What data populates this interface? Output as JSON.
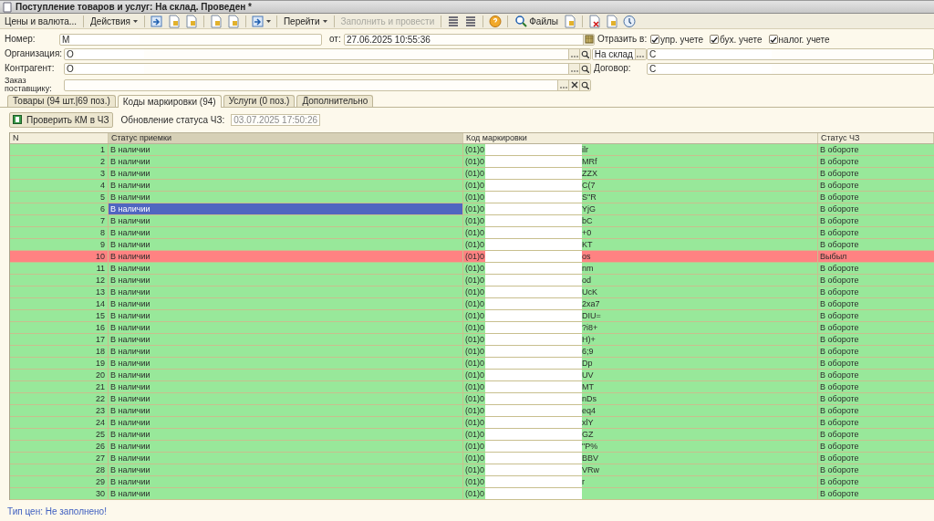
{
  "window": {
    "title": "Поступление товаров и услуг: На склад. Проведен *"
  },
  "toolbar": [
    {
      "kind": "text",
      "label": "Цены и валюта...",
      "dropdown": false,
      "disabled": false
    },
    {
      "kind": "sep"
    },
    {
      "kind": "text",
      "label": "Действия",
      "dropdown": true,
      "disabled": false
    },
    {
      "kind": "sep"
    },
    {
      "kind": "icon"
    },
    {
      "kind": "icon"
    },
    {
      "kind": "icon"
    },
    {
      "kind": "sep"
    },
    {
      "kind": "icon"
    },
    {
      "kind": "icon"
    },
    {
      "kind": "sep"
    },
    {
      "kind": "icon",
      "dropdown": true
    },
    {
      "kind": "sep"
    },
    {
      "kind": "text",
      "label": "Перейти",
      "dropdown": true,
      "disabled": false
    },
    {
      "kind": "sep"
    },
    {
      "kind": "text",
      "label": "Заполнить и провести",
      "dropdown": false,
      "disabled": true
    },
    {
      "kind": "sep"
    },
    {
      "kind": "icon"
    },
    {
      "kind": "icon"
    },
    {
      "kind": "sep"
    },
    {
      "kind": "icon"
    },
    {
      "kind": "sep"
    },
    {
      "kind": "files",
      "label": "Файлы"
    },
    {
      "kind": "icon"
    },
    {
      "kind": "sep"
    },
    {
      "kind": "icon"
    },
    {
      "kind": "icon"
    },
    {
      "kind": "icon"
    }
  ],
  "form": {
    "number": {
      "label": "Номер:",
      "value": "М"
    },
    "date": {
      "label": "от:",
      "value": "27.06.2025 10:55:36"
    },
    "reflect": {
      "label": "Отразить в:",
      "checkboxes": [
        {
          "label": "упр. учете",
          "checked": true
        },
        {
          "label": "бух. учете",
          "checked": true
        },
        {
          "label": "налог. учете",
          "checked": true
        }
      ]
    },
    "organization": {
      "label": "Организация:",
      "value": "О"
    },
    "operation": {
      "value": "На склад"
    },
    "warehouse": {
      "value": "С"
    },
    "counterparty": {
      "label": "Контрагент:",
      "value": "О"
    },
    "contract": {
      "label": "Договор:",
      "value": "С"
    },
    "supplier_order": {
      "label": "Заказ поставщику:"
    }
  },
  "tabs": [
    {
      "label": "Товары (94 шт.|69 поз.)",
      "selected": false
    },
    {
      "label": "Коды маркировки (94)",
      "selected": true
    },
    {
      "label": "Услуги (0 поз.)",
      "selected": false
    },
    {
      "label": "Дополнительно",
      "selected": false
    }
  ],
  "check_button": {
    "label": "Проверить КМ в ЧЗ"
  },
  "status_update": {
    "label": "Обновление статуса ЧЗ:",
    "value": "03.07.2025 17:50:26"
  },
  "table": {
    "columns": [
      "N",
      "Статус приемки",
      "Код маркировки",
      "Статус ЧЗ"
    ],
    "rows": [
      {
        "n": "1",
        "receipt_status": "В наличии",
        "code_prefix": "(01)0",
        "code_suffix": "ilr",
        "cz_status": "В обороте",
        "color": "#98e89a",
        "selected": false
      },
      {
        "n": "2",
        "receipt_status": "В наличии",
        "code_prefix": "(01)0",
        "code_suffix": "MRf",
        "cz_status": "В обороте",
        "color": "#98e89a",
        "selected": false
      },
      {
        "n": "3",
        "receipt_status": "В наличии",
        "code_prefix": "(01)0",
        "code_suffix": "ZZX",
        "cz_status": "В обороте",
        "color": "#98e89a",
        "selected": false
      },
      {
        "n": "4",
        "receipt_status": "В наличии",
        "code_prefix": "(01)0",
        "code_suffix": "C(7",
        "cz_status": "В обороте",
        "color": "#98e89a",
        "selected": false
      },
      {
        "n": "5",
        "receipt_status": "В наличии",
        "code_prefix": "(01)0",
        "code_suffix": "S\"R",
        "cz_status": "В обороте",
        "color": "#98e89a",
        "selected": false
      },
      {
        "n": "6",
        "receipt_status": "В наличии",
        "code_prefix": "(01)0",
        "code_suffix": "YjG",
        "cz_status": "В обороте",
        "color": "#98e89a",
        "selected": true
      },
      {
        "n": "7",
        "receipt_status": "В наличии",
        "code_prefix": "(01)0",
        "code_suffix": "bC",
        "cz_status": "В обороте",
        "color": "#98e89a",
        "selected": false
      },
      {
        "n": "8",
        "receipt_status": "В наличии",
        "code_prefix": "(01)0",
        "code_suffix": "+0",
        "cz_status": "В обороте",
        "color": "#98e89a",
        "selected": false
      },
      {
        "n": "9",
        "receipt_status": "В наличии",
        "code_prefix": "(01)0",
        "code_suffix": "KT",
        "cz_status": "В обороте",
        "color": "#98e89a",
        "selected": false
      },
      {
        "n": "10",
        "receipt_status": "В наличии",
        "code_prefix": "(01)0",
        "code_suffix": "os",
        "cz_status": "Выбыл",
        "color": "#ff8282",
        "selected": false
      },
      {
        "n": "11",
        "receipt_status": "В наличии",
        "code_prefix": "(01)0",
        "code_suffix": "nm",
        "cz_status": "В обороте",
        "color": "#98e89a",
        "selected": false
      },
      {
        "n": "12",
        "receipt_status": "В наличии",
        "code_prefix": "(01)0",
        "code_suffix": "od",
        "cz_status": "В обороте",
        "color": "#98e89a",
        "selected": false
      },
      {
        "n": "13",
        "receipt_status": "В наличии",
        "code_prefix": "(01)0",
        "code_suffix": "UcK",
        "cz_status": "В обороте",
        "color": "#98e89a",
        "selected": false
      },
      {
        "n": "14",
        "receipt_status": "В наличии",
        "code_prefix": "(01)0",
        "code_suffix": "2xa7",
        "cz_status": "В обороте",
        "color": "#98e89a",
        "selected": false
      },
      {
        "n": "15",
        "receipt_status": "В наличии",
        "code_prefix": "(01)0",
        "code_suffix": "DIU=",
        "cz_status": "В обороте",
        "color": "#98e89a",
        "selected": false
      },
      {
        "n": "16",
        "receipt_status": "В наличии",
        "code_prefix": "(01)0",
        "code_suffix": "?i8+",
        "cz_status": "В обороте",
        "color": "#98e89a",
        "selected": false
      },
      {
        "n": "17",
        "receipt_status": "В наличии",
        "code_prefix": "(01)0",
        "code_suffix": "H)+",
        "cz_status": "В обороте",
        "color": "#98e89a",
        "selected": false
      },
      {
        "n": "18",
        "receipt_status": "В наличии",
        "code_prefix": "(01)0",
        "code_suffix": "6;9",
        "cz_status": "В обороте",
        "color": "#98e89a",
        "selected": false
      },
      {
        "n": "19",
        "receipt_status": "В наличии",
        "code_prefix": "(01)0",
        "code_suffix": "Dp",
        "cz_status": "В обороте",
        "color": "#98e89a",
        "selected": false
      },
      {
        "n": "20",
        "receipt_status": "В наличии",
        "code_prefix": "(01)0",
        "code_suffix": "UV",
        "cz_status": "В обороте",
        "color": "#98e89a",
        "selected": false
      },
      {
        "n": "21",
        "receipt_status": "В наличии",
        "code_prefix": "(01)0",
        "code_suffix": "MT",
        "cz_status": "В обороте",
        "color": "#98e89a",
        "selected": false
      },
      {
        "n": "22",
        "receipt_status": "В наличии",
        "code_prefix": "(01)0",
        "code_suffix": "nDs",
        "cz_status": "В обороте",
        "color": "#98e89a",
        "selected": false
      },
      {
        "n": "23",
        "receipt_status": "В наличии",
        "code_prefix": "(01)0",
        "code_suffix": "eq4",
        "cz_status": "В обороте",
        "color": "#98e89a",
        "selected": false
      },
      {
        "n": "24",
        "receipt_status": "В наличии",
        "code_prefix": "(01)0",
        "code_suffix": "xlY",
        "cz_status": "В обороте",
        "color": "#98e89a",
        "selected": false
      },
      {
        "n": "25",
        "receipt_status": "В наличии",
        "code_prefix": "(01)0",
        "code_suffix": "GZ",
        "cz_status": "В обороте",
        "color": "#98e89a",
        "selected": false
      },
      {
        "n": "26",
        "receipt_status": "В наличии",
        "code_prefix": "(01)0",
        "code_suffix": "\"P%",
        "cz_status": "В обороте",
        "color": "#98e89a",
        "selected": false
      },
      {
        "n": "27",
        "receipt_status": "В наличии",
        "code_prefix": "(01)0",
        "code_suffix": "BBV",
        "cz_status": "В обороте",
        "color": "#98e89a",
        "selected": false
      },
      {
        "n": "28",
        "receipt_status": "В наличии",
        "code_prefix": "(01)0",
        "code_suffix": "VRw",
        "cz_status": "В обороте",
        "color": "#98e89a",
        "selected": false
      },
      {
        "n": "29",
        "receipt_status": "В наличии",
        "code_prefix": "(01)0",
        "code_suffix": "r",
        "cz_status": "В обороте",
        "color": "#98e89a",
        "selected": false
      },
      {
        "n": "30",
        "receipt_status": "В наличии",
        "code_prefix": "(01)0",
        "cz_status": "В обороте",
        "color": "#98e89a",
        "selected": false
      }
    ]
  },
  "footer": {
    "price_type": "Тип цен: Не заполнено!"
  }
}
